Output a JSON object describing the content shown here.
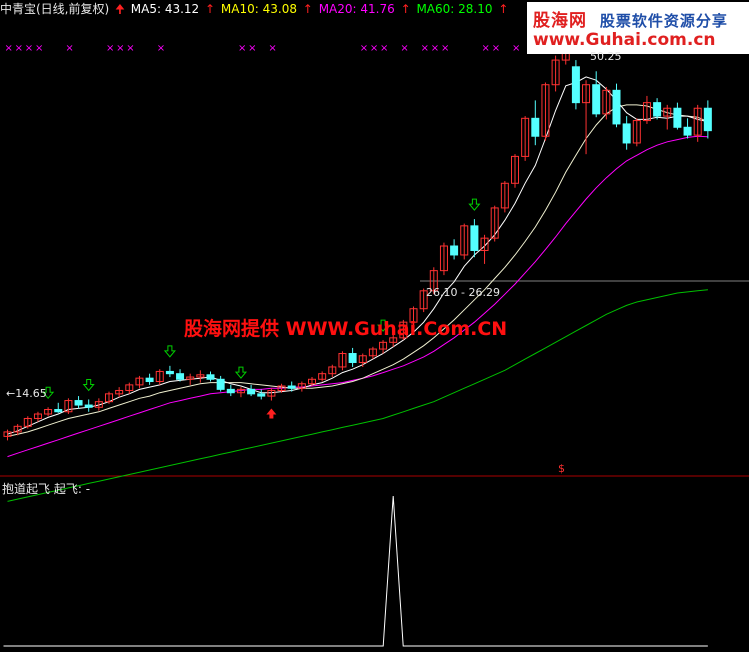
{
  "header": {
    "title": "中青宝(日线,前复权)",
    "ma5": "MA5: 43.12",
    "ma10": "MA10: 43.08",
    "ma20": "MA20: 41.76",
    "ma60": "MA60: 28.10",
    "colors": {
      "title": "#e8e8e8",
      "ma5": "#ffffff",
      "ma10": "#ffff00",
      "ma20": "#ff00ff",
      "ma60": "#00ff00",
      "arrow": "#ff2020"
    }
  },
  "watermark_top": {
    "brand_blue": "股海网",
    "tagline": "股票软件资源分享",
    "url": "www.Guhai.com.cn"
  },
  "watermark_center": "股海网提供 WWW.Guhai.Com.CN",
  "labels": {
    "low": "14.65",
    "high": "50.25",
    "range": "26.10 - 26.29",
    "dollar": "$"
  },
  "sub_panel": {
    "indicator_name": "抱道起飞",
    "line_label": "起飞: -"
  },
  "colors": {
    "background": "#000000",
    "up_candle": "#ff3232",
    "down_candle": "#54ffff",
    "ma5_line": "#ffffff",
    "ma10_line": "#ffff00",
    "ma20_line": "#ff00ff",
    "ma60_line": "#00c000",
    "divider": "#aa0000",
    "buy_arrow": "#00d000",
    "star": "#ff00ff"
  },
  "chart_data": {
    "type": "candlestick",
    "price_range": [
      12,
      52
    ],
    "ohlc": [
      [
        15.0,
        15.6,
        14.65,
        15.4
      ],
      [
        15.4,
        16.1,
        15.1,
        15.9
      ],
      [
        15.9,
        16.8,
        15.7,
        16.6
      ],
      [
        16.6,
        17.2,
        16.3,
        17.0
      ],
      [
        17.0,
        17.6,
        16.8,
        17.4
      ],
      [
        17.4,
        18.0,
        17.1,
        17.2
      ],
      [
        17.2,
        18.4,
        17.0,
        18.2
      ],
      [
        18.2,
        18.6,
        17.5,
        17.8
      ],
      [
        17.8,
        18.3,
        17.2,
        17.6
      ],
      [
        17.6,
        18.4,
        17.3,
        18.1
      ],
      [
        18.1,
        19.0,
        17.9,
        18.8
      ],
      [
        18.8,
        19.4,
        18.5,
        19.1
      ],
      [
        19.1,
        19.8,
        18.8,
        19.6
      ],
      [
        19.6,
        20.4,
        19.3,
        20.2
      ],
      [
        20.2,
        20.6,
        19.6,
        19.9
      ],
      [
        19.9,
        21.0,
        19.6,
        20.8
      ],
      [
        20.8,
        21.3,
        20.3,
        20.6
      ],
      [
        20.6,
        21.0,
        19.9,
        20.1
      ],
      [
        20.1,
        20.6,
        19.6,
        20.3
      ],
      [
        20.3,
        20.9,
        19.8,
        20.5
      ],
      [
        20.5,
        20.8,
        19.9,
        20.1
      ],
      [
        20.1,
        20.4,
        19.0,
        19.2
      ],
      [
        19.2,
        19.6,
        18.6,
        18.9
      ],
      [
        18.9,
        19.4,
        18.5,
        19.2
      ],
      [
        19.2,
        19.6,
        18.6,
        18.8
      ],
      [
        18.8,
        19.2,
        18.3,
        18.6
      ],
      [
        18.6,
        19.3,
        18.2,
        19.1
      ],
      [
        19.1,
        19.7,
        18.9,
        19.5
      ],
      [
        19.5,
        19.9,
        19.0,
        19.3
      ],
      [
        19.3,
        19.9,
        19.0,
        19.7
      ],
      [
        19.7,
        20.3,
        19.5,
        20.1
      ],
      [
        20.1,
        20.8,
        19.9,
        20.6
      ],
      [
        20.6,
        21.4,
        20.3,
        21.2
      ],
      [
        21.2,
        22.6,
        20.9,
        22.4
      ],
      [
        22.4,
        22.9,
        21.2,
        21.6
      ],
      [
        21.6,
        22.4,
        21.2,
        22.2
      ],
      [
        22.2,
        23.0,
        21.9,
        22.8
      ],
      [
        22.8,
        23.6,
        22.4,
        23.4
      ],
      [
        23.4,
        24.2,
        23.0,
        23.8
      ],
      [
        23.8,
        25.4,
        23.6,
        25.2
      ],
      [
        25.2,
        26.6,
        24.9,
        26.4
      ],
      [
        26.4,
        28.2,
        26.1,
        28.0
      ],
      [
        28.0,
        30.1,
        27.7,
        29.8
      ],
      [
        29.8,
        32.3,
        29.4,
        32.0
      ],
      [
        32.0,
        32.6,
        30.8,
        31.2
      ],
      [
        31.2,
        34.0,
        30.8,
        33.8
      ],
      [
        33.8,
        34.4,
        31.0,
        31.6
      ],
      [
        31.6,
        33.0,
        30.4,
        32.7
      ],
      [
        32.7,
        35.6,
        32.4,
        35.4
      ],
      [
        35.4,
        37.8,
        35.0,
        37.6
      ],
      [
        37.6,
        40.2,
        37.2,
        40.0
      ],
      [
        40.0,
        43.6,
        39.6,
        43.4
      ],
      [
        43.4,
        45.0,
        41.0,
        41.8
      ],
      [
        41.8,
        46.6,
        41.4,
        46.4
      ],
      [
        46.4,
        49.0,
        45.8,
        48.6
      ],
      [
        48.6,
        51.2,
        48.2,
        50.25
      ],
      [
        48.0,
        48.6,
        44.2,
        44.8
      ],
      [
        44.8,
        46.8,
        40.2,
        46.4
      ],
      [
        46.4,
        47.6,
        43.5,
        43.8
      ],
      [
        43.8,
        46.2,
        43.3,
        45.9
      ],
      [
        45.9,
        46.5,
        42.6,
        42.9
      ],
      [
        42.9,
        43.6,
        40.6,
        41.2
      ],
      [
        41.2,
        43.4,
        40.9,
        43.2
      ],
      [
        43.2,
        45.4,
        42.9,
        44.8
      ],
      [
        44.8,
        45.2,
        43.3,
        43.6
      ],
      [
        43.6,
        44.6,
        42.4,
        44.3
      ],
      [
        44.3,
        44.8,
        42.4,
        42.6
      ],
      [
        42.6,
        43.4,
        41.6,
        41.9
      ],
      [
        41.9,
        44.6,
        41.3,
        44.3
      ],
      [
        44.3,
        45.0,
        41.6,
        42.3
      ]
    ],
    "ma5": [
      15.2,
      15.5,
      15.9,
      16.3,
      16.7,
      17.0,
      17.4,
      17.5,
      17.6,
      17.8,
      18.1,
      18.5,
      18.8,
      19.2,
      19.4,
      19.6,
      19.9,
      20.0,
      20.1,
      20.2,
      20.3,
      20.0,
      19.7,
      19.5,
      19.2,
      18.9,
      18.9,
      19.0,
      19.1,
      19.3,
      19.6,
      19.8,
      20.2,
      20.7,
      21.0,
      21.4,
      21.9,
      22.4,
      23.0,
      23.6,
      24.3,
      25.2,
      26.4,
      27.8,
      28.8,
      30.2,
      31.2,
      32.0,
      33.0,
      34.3,
      35.8,
      37.6,
      39.2,
      41.6,
      44.1,
      46.3,
      46.6,
      47.1,
      46.8,
      46.0,
      45.0,
      43.9,
      43.3,
      43.3,
      43.5,
      43.4,
      43.6,
      43.6,
      43.3,
      43.1
    ],
    "ma10": [
      15.0,
      15.2,
      15.4,
      15.7,
      16.0,
      16.3,
      16.6,
      16.8,
      17.0,
      17.2,
      17.5,
      17.8,
      18.1,
      18.4,
      18.6,
      18.9,
      19.1,
      19.3,
      19.5,
      19.7,
      19.8,
      19.8,
      19.8,
      19.8,
      19.7,
      19.6,
      19.5,
      19.4,
      19.3,
      19.3,
      19.3,
      19.4,
      19.5,
      19.7,
      19.9,
      20.2,
      20.6,
      21.0,
      21.4,
      21.9,
      22.5,
      23.1,
      23.8,
      24.6,
      25.4,
      26.3,
      27.2,
      28.1,
      29.1,
      30.1,
      31.2,
      32.4,
      33.7,
      35.2,
      36.8,
      38.6,
      40.1,
      41.6,
      42.8,
      43.8,
      44.4,
      44.6,
      44.6,
      44.5,
      44.2,
      43.9,
      43.7,
      43.6,
      43.5,
      43.1
    ],
    "ma20": [
      13.2,
      13.5,
      13.8,
      14.1,
      14.4,
      14.7,
      15.0,
      15.3,
      15.6,
      15.9,
      16.2,
      16.5,
      16.8,
      17.1,
      17.4,
      17.7,
      18.0,
      18.2,
      18.4,
      18.6,
      18.8,
      18.9,
      19.0,
      19.1,
      19.2,
      19.2,
      19.3,
      19.3,
      19.4,
      19.4,
      19.5,
      19.6,
      19.7,
      19.8,
      20.0,
      20.2,
      20.4,
      20.7,
      21.0,
      21.3,
      21.7,
      22.1,
      22.6,
      23.2,
      23.8,
      24.5,
      25.2,
      26.0,
      26.8,
      27.7,
      28.6,
      29.6,
      30.6,
      31.7,
      32.8,
      34.0,
      35.1,
      36.2,
      37.2,
      38.1,
      38.9,
      39.6,
      40.1,
      40.6,
      41.0,
      41.3,
      41.5,
      41.7,
      41.8,
      41.76
    ],
    "ma60": [
      9.2,
      9.4,
      9.6,
      9.8,
      10.0,
      10.2,
      10.4,
      10.6,
      10.8,
      11.0,
      11.2,
      11.4,
      11.6,
      11.8,
      12.0,
      12.2,
      12.4,
      12.6,
      12.8,
      13.0,
      13.2,
      13.4,
      13.6,
      13.8,
      14.0,
      14.2,
      14.4,
      14.6,
      14.8,
      15.0,
      15.2,
      15.4,
      15.6,
      15.8,
      16.0,
      16.2,
      16.4,
      16.6,
      16.9,
      17.2,
      17.5,
      17.8,
      18.1,
      18.5,
      18.9,
      19.3,
      19.7,
      20.1,
      20.5,
      20.9,
      21.4,
      21.9,
      22.4,
      22.9,
      23.4,
      23.9,
      24.4,
      24.9,
      25.4,
      25.9,
      26.3,
      26.7,
      27.0,
      27.2,
      27.4,
      27.6,
      27.8,
      27.9,
      28.0,
      28.1
    ],
    "buy_arrows": [
      4,
      8,
      16,
      23,
      37,
      46,
      55
    ],
    "red_arrows": [
      26
    ],
    "stars": [
      0,
      1,
      2,
      3,
      6,
      10,
      11,
      12,
      15,
      23,
      24,
      26,
      35,
      36,
      37,
      39,
      41,
      42,
      43,
      47,
      48,
      50,
      52,
      53,
      59,
      65
    ],
    "signal": {
      "x_range": [
        0,
        69
      ],
      "spike_index": 38,
      "width": 1,
      "y_range": [
        0,
        1
      ]
    }
  }
}
